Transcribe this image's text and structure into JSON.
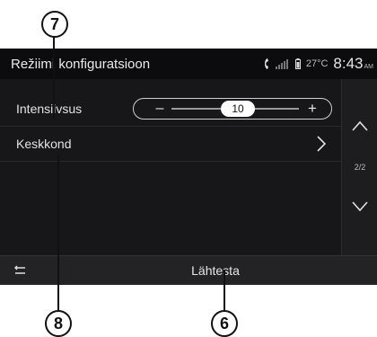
{
  "header": {
    "title": "Režiimi konfiguratsioon",
    "temperature": "27°C",
    "time": "8:43",
    "ampm": "AM"
  },
  "settings": {
    "rows": [
      {
        "label": "Intensiivsus",
        "minus": "–",
        "plus": "+",
        "value": "10"
      },
      {
        "label": "Keskkond"
      }
    ]
  },
  "side": {
    "page_indicator": "2/2"
  },
  "footer": {
    "reset_label": "Lähtesta"
  },
  "callouts": {
    "c7": "7",
    "c8": "8",
    "c6": "6"
  },
  "icons": [
    "phone-icon",
    "signal-icon",
    "battery-icon",
    "chevron-right-icon",
    "chevron-up-icon",
    "chevron-down-icon",
    "back-icon"
  ]
}
